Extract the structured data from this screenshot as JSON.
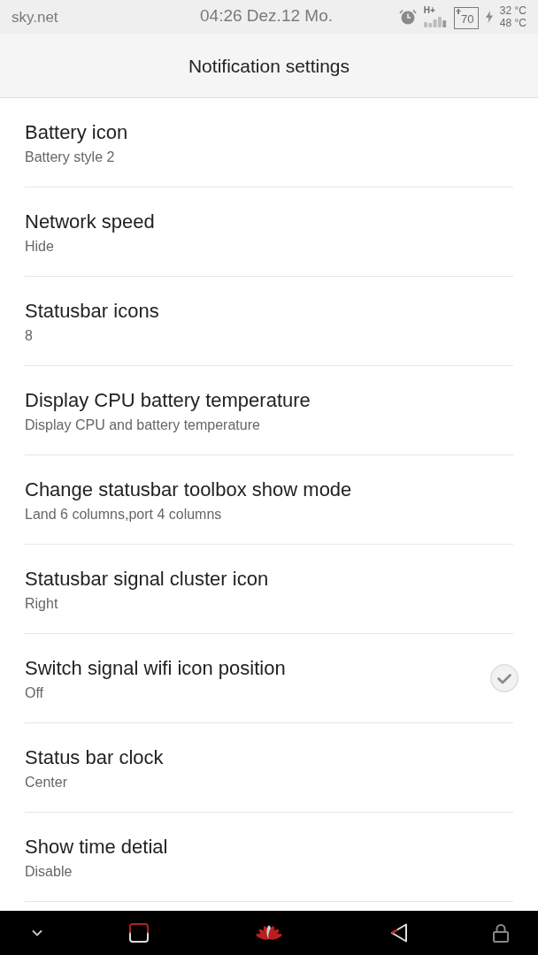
{
  "status_bar": {
    "carrier": "sky.net",
    "clock": "04:26 Dez.12 Mo.",
    "network_type": "H+",
    "battery": "70",
    "temperatures": [
      "32 °C",
      "48 °C"
    ]
  },
  "header": {
    "title": "Notification settings"
  },
  "settings": [
    {
      "kind": "list",
      "title": "Battery icon",
      "summary": "Battery style 2"
    },
    {
      "kind": "list",
      "title": "Network speed",
      "summary": "Hide"
    },
    {
      "kind": "list",
      "title": "Statusbar icons",
      "summary": "8"
    },
    {
      "kind": "list",
      "title": "Display CPU battery temperature",
      "summary": "Display CPU and battery temperature"
    },
    {
      "kind": "list",
      "title": "Change statusbar toolbox show mode",
      "summary": "Land 6 columns,port 4 columns"
    },
    {
      "kind": "list",
      "title": "Statusbar signal cluster icon",
      "summary": "Right"
    },
    {
      "kind": "checkbox",
      "title": "Switch signal wifi icon position",
      "summary": "Off",
      "checked": false
    },
    {
      "kind": "list",
      "title": "Status bar clock",
      "summary": "Center"
    },
    {
      "kind": "list",
      "title": "Show time detial",
      "summary": "Disable"
    }
  ]
}
